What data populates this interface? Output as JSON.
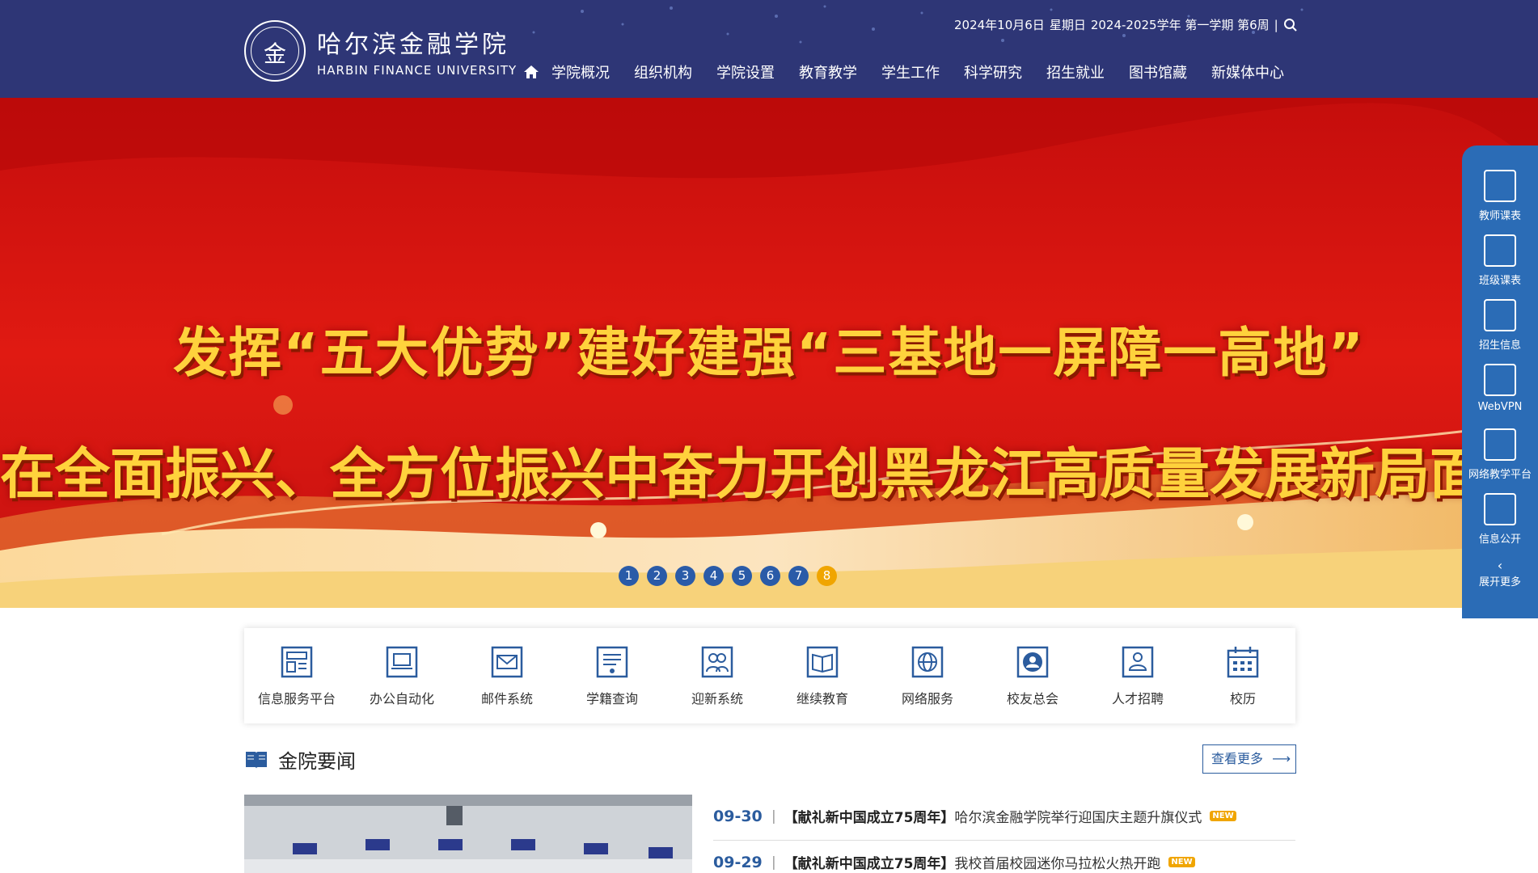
{
  "header": {
    "logo_cn": "哈尔滨金融学院",
    "logo_en": "HARBIN FINANCE UNIVERSITY",
    "seal_char": "金",
    "date": "2024年10月6日",
    "weekday": "星期日",
    "term": "2024-2025学年 第一学期 第6周",
    "nav": [
      "学院概况",
      "组织机构",
      "学院设置",
      "教育教学",
      "学生工作",
      "科学研究",
      "招生就业",
      "图书馆藏",
      "新媒体中心"
    ]
  },
  "banner": {
    "slogan1": "发挥“五大优势”建好建强“三基地一屏障一高地”",
    "slogan2": "在全面振兴、全方位振兴中奋力开创黑龙江高质量发展新局面",
    "dots": [
      "1",
      "2",
      "3",
      "4",
      "5",
      "6",
      "7",
      "8"
    ],
    "active_dot": "8"
  },
  "sidebar": {
    "items": [
      "教师课表",
      "班级课表",
      "招生信息",
      "WebVPN",
      "网络教学平台",
      "信息公开"
    ],
    "expand": "展开更多"
  },
  "quick_links": [
    "信息服务平台",
    "办公自动化",
    "邮件系统",
    "学籍查询",
    "迎新系统",
    "继续教育",
    "网络服务",
    "校友总会",
    "人才招聘",
    "校历"
  ],
  "news_section": {
    "title": "金院要闻",
    "more": "查看更多",
    "items": [
      {
        "date": "09-30",
        "tag": "【献礼新中国成立75周年】",
        "title": "哈尔滨金融学院举行迎国庆主题升旗仪式",
        "badge": "NEW"
      },
      {
        "date": "09-29",
        "tag": "【献礼新中国成立75周年】",
        "title": "我校首届校园迷你马拉松火热开跑",
        "badge": "NEW"
      }
    ]
  },
  "colors": {
    "header_bg": "#2e3676",
    "banner_red": "#d8130f",
    "accent_blue": "#2b5c9e",
    "gold": "#f0a500"
  }
}
